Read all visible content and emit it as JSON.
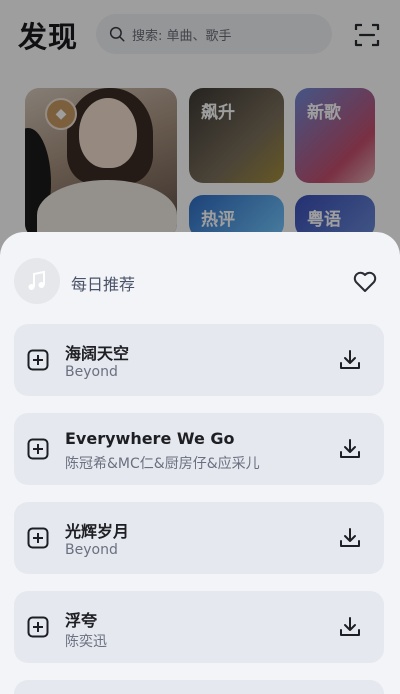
{
  "header": {
    "title": "发现",
    "search_placeholder": "搜索: 单曲、歌手"
  },
  "cards": {
    "rise": "飙升",
    "new": "新歌",
    "hot_comments": "热评",
    "cantonese": "粤语"
  },
  "sheet": {
    "title": "每日推荐",
    "songs": [
      {
        "name": "海阔天空",
        "artist": "Beyond"
      },
      {
        "name": "Everywhere We Go",
        "artist": "陈冠希&MC仁&厨房仔&应采儿"
      },
      {
        "name": "光辉岁月",
        "artist": "Beyond"
      },
      {
        "name": "浮夸",
        "artist": "陈奕迅"
      }
    ]
  },
  "icons": {
    "search": "search-icon",
    "scan": "scan-icon",
    "heart": "heart-icon",
    "add": "add-icon",
    "download": "download-icon",
    "music": "music-note-icon"
  },
  "colors": {
    "sheet_bg": "#f2f4f8",
    "song_card_bg": "#e5e8ee",
    "title_text": "#4a5368"
  }
}
